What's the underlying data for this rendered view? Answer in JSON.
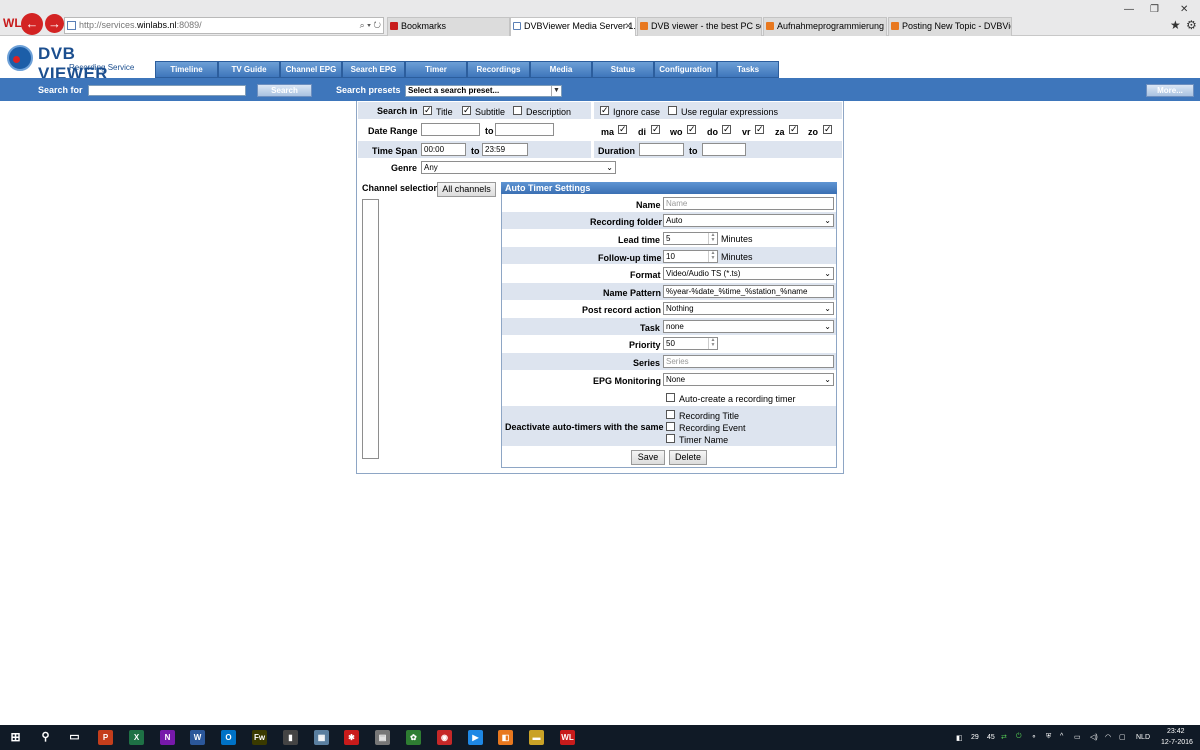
{
  "browser": {
    "address": {
      "prefix": "http://services.",
      "host": "winlabs.nl",
      "suffix": ":8089/",
      "controls": "⌕ ▾ ↻"
    },
    "tabs": [
      {
        "label": "Bookmarks"
      },
      {
        "label": "DVBViewer Media Server 1.3...",
        "active": true
      },
      {
        "label": "DVB viewer - the best PC softw..."
      },
      {
        "label": "Aufnahmeprogrammierung W..."
      },
      {
        "label": "Posting New Topic - DVBViewe..."
      }
    ],
    "window_controls": {
      "minimize": "—",
      "restore": "❐",
      "close": "✕"
    },
    "brand_mark": "WL"
  },
  "app": {
    "logo_title": "DVB VIEWER",
    "logo_subtitle": "Recording Service",
    "nav": [
      "Timeline",
      "TV Guide",
      "Channel EPG",
      "Search EPG",
      "Timer",
      "Recordings",
      "Media",
      "Status",
      "Configuration",
      "Tasks"
    ]
  },
  "searchbar": {
    "search_for_label": "Search for",
    "search_button": "Search",
    "presets_label": "Search presets",
    "preset_value": "Select a search preset...",
    "more_button": "More..."
  },
  "form": {
    "search_in_label": "Search in",
    "title_label": "Title",
    "subtitle_label": "Subtitle",
    "description_label": "Description",
    "ignore_case_label": "Ignore case",
    "regex_label": "Use regular expressions",
    "date_range_label": "Date Range",
    "to_label": "to",
    "days": [
      "ma",
      "di",
      "wo",
      "do",
      "vr",
      "za",
      "zo"
    ],
    "time_span_label": "Time Span",
    "time_from": "00:00",
    "time_to": "23:59",
    "duration_label": "Duration",
    "genre_label": "Genre",
    "genre_value": "Any",
    "channel_selection_label": "Channel selection",
    "all_channels_button": "All channels"
  },
  "auto_timer": {
    "header": "Auto Timer Settings",
    "name_label": "Name",
    "name_placeholder": "Name",
    "recording_folder_label": "Recording folder",
    "recording_folder_value": "Auto",
    "lead_time_label": "Lead time",
    "lead_time_value": "5",
    "minutes_label": "Minutes",
    "follow_up_label": "Follow-up time",
    "follow_up_value": "10",
    "format_label": "Format",
    "format_value": "Video/Audio TS (*.ts)",
    "name_pattern_label": "Name Pattern",
    "name_pattern_value": "%year-%date_%time_%station_%name",
    "post_record_label": "Post record action",
    "post_record_value": "Nothing",
    "task_label": "Task",
    "task_value": "none",
    "priority_label": "Priority",
    "priority_value": "50",
    "series_label": "Series",
    "series_placeholder": "Series",
    "epg_monitoring_label": "EPG Monitoring",
    "epg_monitoring_value": "None",
    "auto_create_label": "Auto-create a recording timer",
    "deactivate_label": "Deactivate auto-timers with the same",
    "recording_title_label": "Recording Title",
    "recording_event_label": "Recording Event",
    "timer_name_label": "Timer Name",
    "save_button": "Save",
    "delete_button": "Delete"
  },
  "taskbar": {
    "start": "⊞",
    "search": "⚲",
    "task_view": "▭",
    "apps": [
      {
        "label": "P",
        "color": "#c43e1c"
      },
      {
        "label": "X",
        "color": "#1e7145"
      },
      {
        "label": "N",
        "color": "#7719aa"
      },
      {
        "label": "W",
        "color": "#2b579a"
      },
      {
        "label": "O",
        "color": "#0072c6"
      },
      {
        "label": "Fw",
        "color": "#3a3a00"
      },
      {
        "label": "▮",
        "color": "#444"
      },
      {
        "label": "▦",
        "color": "#5a7fa0"
      },
      {
        "label": "✱",
        "color": "#c81b1b"
      },
      {
        "label": "▤",
        "color": "#777"
      },
      {
        "label": "✿",
        "color": "#2e7d32"
      },
      {
        "label": "◉",
        "color": "#c62828"
      },
      {
        "label": "▶",
        "color": "#1e88e5"
      },
      {
        "label": "◧",
        "color": "#e8781f"
      },
      {
        "label": "▬",
        "color": "#c9a227"
      },
      {
        "label": "WL",
        "color": "#c81b1b"
      }
    ],
    "tray_numbers": [
      "29",
      "45"
    ],
    "language": "NLD",
    "time": "23:42",
    "date": "12-7-2016"
  }
}
